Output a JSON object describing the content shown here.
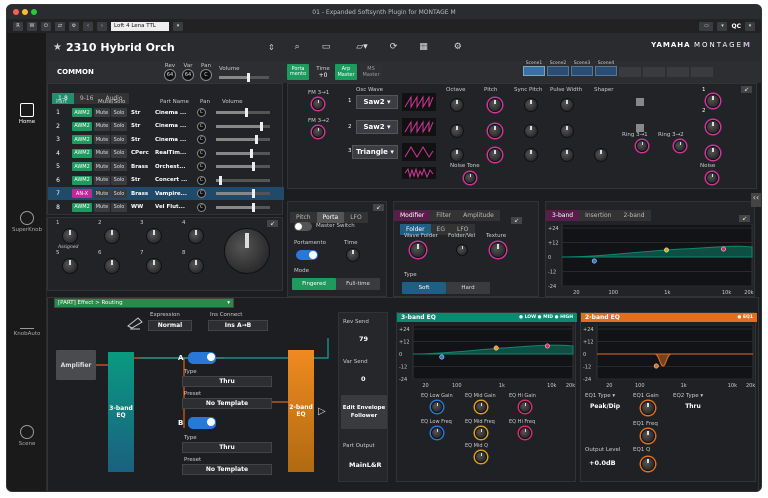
{
  "window": {
    "title": "01 - Expanded Softsynth Plugin for MONTAGE M"
  },
  "toolbar": {
    "preset": "Loft 4 Lena TTL",
    "qc": "QC"
  },
  "sidebar": {
    "items": [
      {
        "label": "Home"
      },
      {
        "label": "SuperKnob"
      },
      {
        "label": "KnobAuto"
      },
      {
        "label": "Scene"
      }
    ]
  },
  "header": {
    "performance_name": "2310 Hybrid Orch",
    "brand": "YAMAHA",
    "model": "MONTAGE",
    "model_suffix": "M"
  },
  "common": {
    "label": "COMMON",
    "rev_label": "Rev",
    "rev_value": "64",
    "var_label": "Var",
    "var_value": "64",
    "pan_label": "Pan",
    "pan_value": "C",
    "volume_label": "Volume",
    "portamento": "Porta mento",
    "time_label": "Time",
    "time_value": "+0",
    "arp_master": "Arp Master",
    "ms_master": "MS Master",
    "scenes": [
      "Scene1",
      "Scene2",
      "Scene3",
      "Scene4"
    ]
  },
  "parts": {
    "tabs": [
      "1-8",
      "9-16",
      "Audio"
    ],
    "headers": [
      "Part",
      "Mute/Solo",
      "Part Name",
      "Pan",
      "Volume"
    ],
    "rows": [
      {
        "num": "1",
        "type": "AWM2",
        "mute": "Mute",
        "solo": "Solo",
        "cat": "Str",
        "name": "Cinema ...",
        "pan": "C",
        "vol": 0.55
      },
      {
        "num": "2",
        "type": "AWM2",
        "mute": "Mute",
        "solo": "Solo",
        "cat": "Str",
        "name": "Cinema ...",
        "pan": "C",
        "vol": 0.85
      },
      {
        "num": "3",
        "type": "AWM2",
        "mute": "Mute",
        "solo": "Solo",
        "cat": "Str",
        "name": "Cinema ...",
        "pan": "C",
        "vol": 0.75
      },
      {
        "num": "4",
        "type": "AWM2",
        "mute": "Mute",
        "solo": "Solo",
        "cat": "CPerc",
        "name": "RealTim...",
        "pan": "C",
        "vol": 0.65
      },
      {
        "num": "5",
        "type": "AWM2",
        "mute": "Mute",
        "solo": "Solo",
        "cat": "Brass",
        "name": "Orchest...",
        "pan": "C",
        "vol": 0.7
      },
      {
        "num": "6",
        "type": "AWM2",
        "mute": "Mute",
        "solo": "Solo",
        "cat": "Str",
        "name": "Concert ...",
        "pan": "C",
        "vol": 0.05
      },
      {
        "num": "7",
        "type": "AN-X",
        "mute": "Mute",
        "solo": "Solo",
        "cat": "Brass",
        "name": "Vampire...",
        "pan": "C",
        "vol": 0.7
      },
      {
        "num": "8",
        "type": "AWM2",
        "mute": "Mute",
        "solo": "Solo",
        "cat": "WW",
        "name": "Vel Flut...",
        "pan": "C",
        "vol": 0.7
      }
    ]
  },
  "knobs": {
    "numbers": [
      "1",
      "2",
      "3",
      "4",
      "5",
      "6",
      "7",
      "8"
    ],
    "assigned": "Assigned"
  },
  "oscillators": {
    "fm_labels": [
      "FM 3→1",
      "FM 3→2"
    ],
    "osc_wave_label": "Osc Wave",
    "waves": [
      "Saw2",
      "Saw2",
      "Triangle"
    ],
    "osc_nums": [
      "1",
      "2",
      "3"
    ],
    "params": [
      "Octave",
      "Pitch",
      "Sync Pitch",
      "Pulse Width",
      "Shaper"
    ],
    "ring_labels": [
      "Ring 3→1",
      "Ring 3→2"
    ],
    "noise_tone": "Noise Tone",
    "noise": "Noise",
    "out_nums": [
      "1",
      "2"
    ]
  },
  "porta": {
    "tabs": [
      "Pitch",
      "Porta",
      "LFO"
    ],
    "master_switch": "Master Switch",
    "portamento": "Portamento",
    "time": "Time",
    "mode": "Mode",
    "mode_fingered": "Fingered",
    "mode_fulltime": "Full-time"
  },
  "modifier": {
    "tabs": [
      "Modifier",
      "Filter",
      "Amplitude"
    ],
    "subtabs": [
      "Folder",
      "EG",
      "LFO"
    ],
    "wave_folder": "Wave Folder",
    "folder_vel": "Folder/Vel",
    "texture": "Texture",
    "type": "Type",
    "soft": "Soft",
    "hard": "Hard"
  },
  "eq_top": {
    "tabs": [
      "3-band",
      "Insertion",
      "2-band"
    ],
    "y_labels": [
      "+24",
      "+12",
      "0",
      "-12",
      "-24"
    ],
    "x_labels": [
      "20",
      "100",
      "1k",
      "10k",
      "20k"
    ],
    "legend": [
      "LOW",
      "MID",
      "HIGH"
    ]
  },
  "routing": {
    "selector": "[PART] Effect > Routing",
    "expression": "Expression",
    "expression_value": "Normal",
    "ins_connect": "Ins Connect",
    "ins_connect_value": "Ins A→B",
    "amplifier": "Amplifier",
    "three_band": "3-band EQ",
    "two_band": "2-band EQ",
    "ins_a": "A",
    "ins_b": "B",
    "type_label": "Type",
    "type_value": "Thru",
    "preset_label": "Preset",
    "preset_value": "No Template",
    "rev_send": "Rev Send",
    "rev_send_value": "79",
    "var_send": "Var Send",
    "var_send_value": "0",
    "envelope": "Edit Envelope Follower",
    "part_output": "Part Output",
    "part_output_value": "MainL&R"
  },
  "eq3": {
    "title": "3-band EQ",
    "legend": [
      "LOW",
      "MID",
      "HIGH"
    ],
    "y_labels": [
      "+24",
      "+12",
      "0",
      "-12",
      "-24"
    ],
    "x_labels": [
      "20",
      "100",
      "1k",
      "10k",
      "20k"
    ],
    "params": [
      "EQ Low Gain",
      "EQ Mid Gain",
      "EQ Hi Gain",
      "EQ Low Freq",
      "EQ Mid Freq",
      "EQ Hi Freq",
      "EQ Mid Q"
    ]
  },
  "eq2": {
    "title": "2-band EQ",
    "legend": [
      "EQ1"
    ],
    "y_labels": [
      "+24",
      "+12",
      "0",
      "-12",
      "-24"
    ],
    "x_labels": [
      "20",
      "100",
      "1k",
      "10k",
      "20k"
    ],
    "eq1_type": "EQ1 Type",
    "eq1_type_value": "Peak/Dip",
    "eq1_gain": "EQ1 Gain",
    "eq2_type": "EQ2 Type",
    "eq2_type_value": "Thru",
    "eq1_freq": "EQ1 Freq",
    "output_level": "Output Level",
    "output_level_value": "+0.0dB",
    "eq1_q": "EQ1 Q"
  },
  "colors": {
    "accent": "#1f9a5f",
    "magenta": "#d0369a",
    "eq3": "#0a8a70",
    "eq2": "#e07020"
  }
}
